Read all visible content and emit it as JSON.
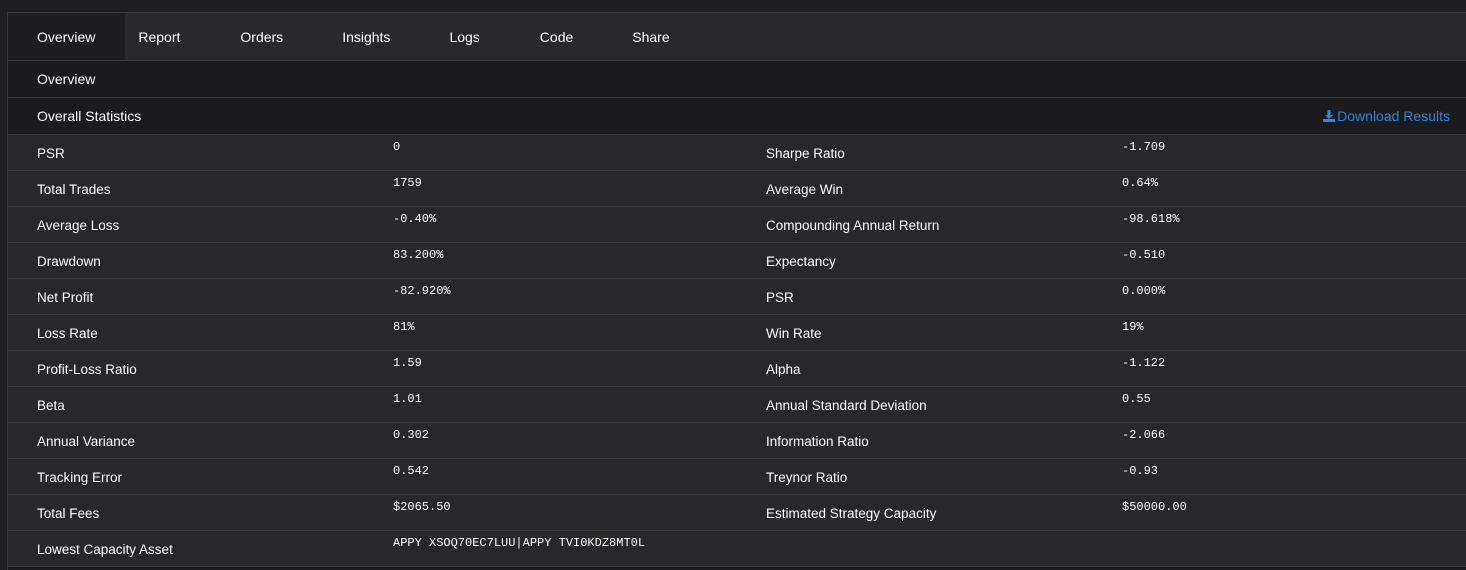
{
  "tabs": [
    {
      "label": "Overview",
      "active": true
    },
    {
      "label": "Report"
    },
    {
      "label": "Orders"
    },
    {
      "label": "Insights"
    },
    {
      "label": "Logs"
    },
    {
      "label": "Code"
    },
    {
      "label": "Share"
    }
  ],
  "section_title": "Overview",
  "stats_header": {
    "title": "Overall Statistics",
    "download_label": "Download Results",
    "download_icon": "download-icon",
    "accent_color": "#2f86d8"
  },
  "stats": [
    {
      "l1": "PSR",
      "v1": "0",
      "l2": "Sharpe Ratio",
      "v2": "-1.709"
    },
    {
      "l1": "Total Trades",
      "v1": "1759",
      "l2": "Average Win",
      "v2": "0.64%"
    },
    {
      "l1": "Average Loss",
      "v1": "-0.40%",
      "l2": "Compounding Annual Return",
      "v2": "-98.618%"
    },
    {
      "l1": "Drawdown",
      "v1": "83.200%",
      "l2": "Expectancy",
      "v2": "-0.510"
    },
    {
      "l1": "Net Profit",
      "v1": "-82.920%",
      "l2": "PSR",
      "v2": "0.000%"
    },
    {
      "l1": "Loss Rate",
      "v1": "81%",
      "l2": "Win Rate",
      "v2": "19%"
    },
    {
      "l1": "Profit-Loss Ratio",
      "v1": "1.59",
      "l2": "Alpha",
      "v2": "-1.122"
    },
    {
      "l1": "Beta",
      "v1": "1.01",
      "l2": "Annual Standard Deviation",
      "v2": "0.55"
    },
    {
      "l1": "Annual Variance",
      "v1": "0.302",
      "l2": "Information Ratio",
      "v2": "-2.066"
    },
    {
      "l1": "Tracking Error",
      "v1": "0.542",
      "l2": "Treynor Ratio",
      "v2": "-0.93"
    },
    {
      "l1": "Total Fees",
      "v1": "$2065.50",
      "l2": "Estimated Strategy Capacity",
      "v2": "$50000.00"
    },
    {
      "l1": "Lowest Capacity Asset",
      "v1": "APPY XSOQ70EC7LUU|APPY TVI0KDZ8MT0L",
      "l2": "",
      "v2": ""
    }
  ]
}
